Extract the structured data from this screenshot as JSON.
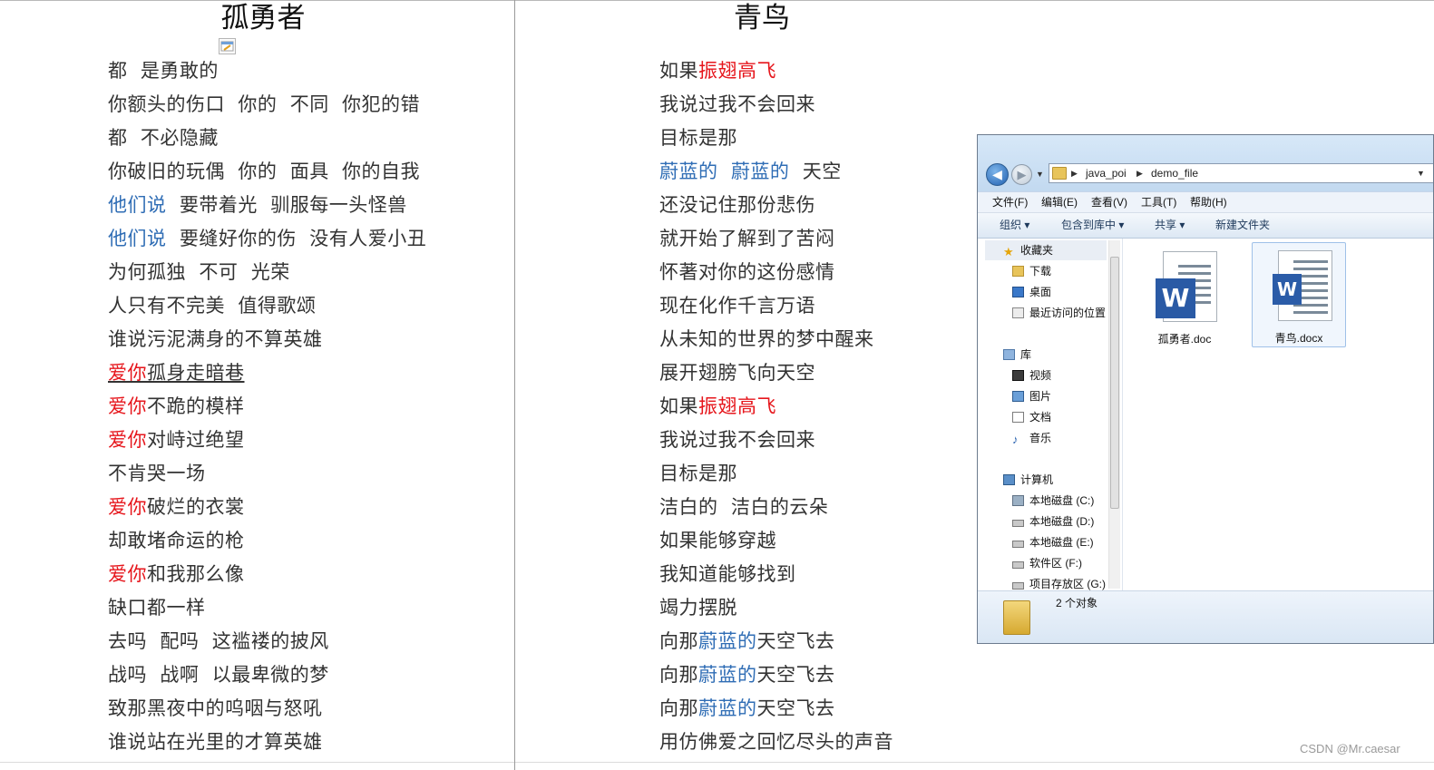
{
  "left_doc": {
    "title": "孤勇者",
    "lines": [
      [
        {
          "t": "都  是勇敢的",
          "c": ""
        }
      ],
      [
        {
          "t": "你额头的伤口  你的  不同  你犯的错",
          "c": ""
        }
      ],
      [
        {
          "t": "都  不必隐藏",
          "c": ""
        }
      ],
      [
        {
          "t": "你破旧的玩偶  你的  面具  你的自我",
          "c": ""
        }
      ],
      [
        {
          "t": "他们说",
          "c": "blue"
        },
        {
          "t": "  要带着光  驯服每一头怪兽",
          "c": ""
        }
      ],
      [
        {
          "t": "他们说",
          "c": "blue"
        },
        {
          "t": "  要缝好你的伤  没有人爱小丑",
          "c": ""
        }
      ],
      [
        {
          "t": "为何孤独  不可  光荣",
          "c": ""
        }
      ],
      [
        {
          "t": "人只有不完美  值得歌颂",
          "c": ""
        }
      ],
      [
        {
          "t": "谁说污泥满身的不算英雄",
          "c": ""
        }
      ],
      [
        {
          "t": "爱你",
          "c": "red ul"
        },
        {
          "t": "孤身走暗巷",
          "c": "ul"
        }
      ],
      [
        {
          "t": "爱你",
          "c": "red"
        },
        {
          "t": "不跪的模样",
          "c": ""
        }
      ],
      [
        {
          "t": "爱你",
          "c": "red"
        },
        {
          "t": "对峙过绝望",
          "c": ""
        }
      ],
      [
        {
          "t": "不肯哭一场",
          "c": ""
        }
      ],
      [
        {
          "t": "爱你",
          "c": "red"
        },
        {
          "t": "破烂的衣裳",
          "c": ""
        }
      ],
      [
        {
          "t": "却敢堵命运的枪",
          "c": ""
        }
      ],
      [
        {
          "t": "爱你",
          "c": "red"
        },
        {
          "t": "和我那么像",
          "c": ""
        }
      ],
      [
        {
          "t": "缺口都一样",
          "c": ""
        }
      ],
      [
        {
          "t": "去吗  配吗  这褴褛的披风",
          "c": ""
        }
      ],
      [
        {
          "t": "战吗  战啊  以最卑微的梦",
          "c": ""
        }
      ],
      [
        {
          "t": "致那黑夜中的呜咽与怒吼",
          "c": ""
        }
      ],
      [
        {
          "t": "谁说站在光里的才算英雄",
          "c": ""
        }
      ]
    ]
  },
  "right_doc": {
    "title": "青鸟",
    "lines": [
      [
        {
          "t": "如果",
          "c": ""
        },
        {
          "t": "振翅高飞",
          "c": "red"
        }
      ],
      [
        {
          "t": "我说过我不会回来",
          "c": ""
        }
      ],
      [
        {
          "t": "目标是那",
          "c": ""
        }
      ],
      [
        {
          "t": "蔚蓝的  蔚蓝的",
          "c": "blue"
        },
        {
          "t": "  天空",
          "c": ""
        }
      ],
      [
        {
          "t": "还没记住那份悲伤",
          "c": ""
        }
      ],
      [
        {
          "t": "就开始了解到了苦闷",
          "c": ""
        }
      ],
      [
        {
          "t": "怀著对你的这份感情",
          "c": ""
        }
      ],
      [
        {
          "t": "现在化作千言万语",
          "c": ""
        }
      ],
      [
        {
          "t": "从未知的世界的梦中醒来",
          "c": ""
        }
      ],
      [
        {
          "t": "展开翅膀飞向天空",
          "c": ""
        }
      ],
      [
        {
          "t": "如果",
          "c": ""
        },
        {
          "t": "振翅高飞",
          "c": "red"
        }
      ],
      [
        {
          "t": "我说过我不会回来",
          "c": ""
        }
      ],
      [
        {
          "t": "目标是那",
          "c": ""
        }
      ],
      [
        {
          "t": "洁白的  洁白的云朵",
          "c": ""
        }
      ],
      [
        {
          "t": "如果能够穿越",
          "c": ""
        }
      ],
      [
        {
          "t": "我知道能够找到",
          "c": ""
        }
      ],
      [
        {
          "t": "竭力摆脱",
          "c": ""
        }
      ],
      [
        {
          "t": "向那",
          "c": ""
        },
        {
          "t": "蔚蓝的",
          "c": "blue"
        },
        {
          "t": "天空飞去",
          "c": ""
        }
      ],
      [
        {
          "t": "向那",
          "c": ""
        },
        {
          "t": "蔚蓝的",
          "c": "blue"
        },
        {
          "t": "天空飞去",
          "c": ""
        }
      ],
      [
        {
          "t": "向那",
          "c": ""
        },
        {
          "t": "蔚蓝的",
          "c": "blue"
        },
        {
          "t": "天空飞去",
          "c": ""
        }
      ],
      [
        {
          "t": "用仿佛爱之回忆尽头的声音",
          "c": ""
        }
      ]
    ]
  },
  "colors": {
    "red": "#e6161c",
    "blue": "#2f6db5",
    "text": "#333333"
  },
  "explorer": {
    "breadcrumb": [
      "java_poi",
      "demo_file"
    ],
    "menu": [
      "文件(F)",
      "编辑(E)",
      "查看(V)",
      "工具(T)",
      "帮助(H)"
    ],
    "toolbar": [
      "组织 ▾",
      "包含到库中 ▾",
      "共享 ▾",
      "新建文件夹"
    ],
    "nav": {
      "favorites": "收藏夹",
      "favorites_items": [
        "下载",
        "桌面",
        "最近访问的位置"
      ],
      "libraries": "库",
      "libraries_items": [
        "视频",
        "图片",
        "文档",
        "音乐"
      ],
      "computer": "计算机",
      "computer_items": [
        "本地磁盘 (C:)",
        "本地磁盘 (D:)",
        "本地磁盘 (E:)",
        "软件区 (F:)",
        "项目存放区 (G:)"
      ]
    },
    "files": [
      {
        "name": "孤勇者.doc",
        "icon": "word-doc-icon"
      },
      {
        "name": "青鸟.docx",
        "icon": "word-docx-icon"
      }
    ],
    "status": "2 个对象"
  },
  "watermark": "CSDN @Mr.caesar"
}
